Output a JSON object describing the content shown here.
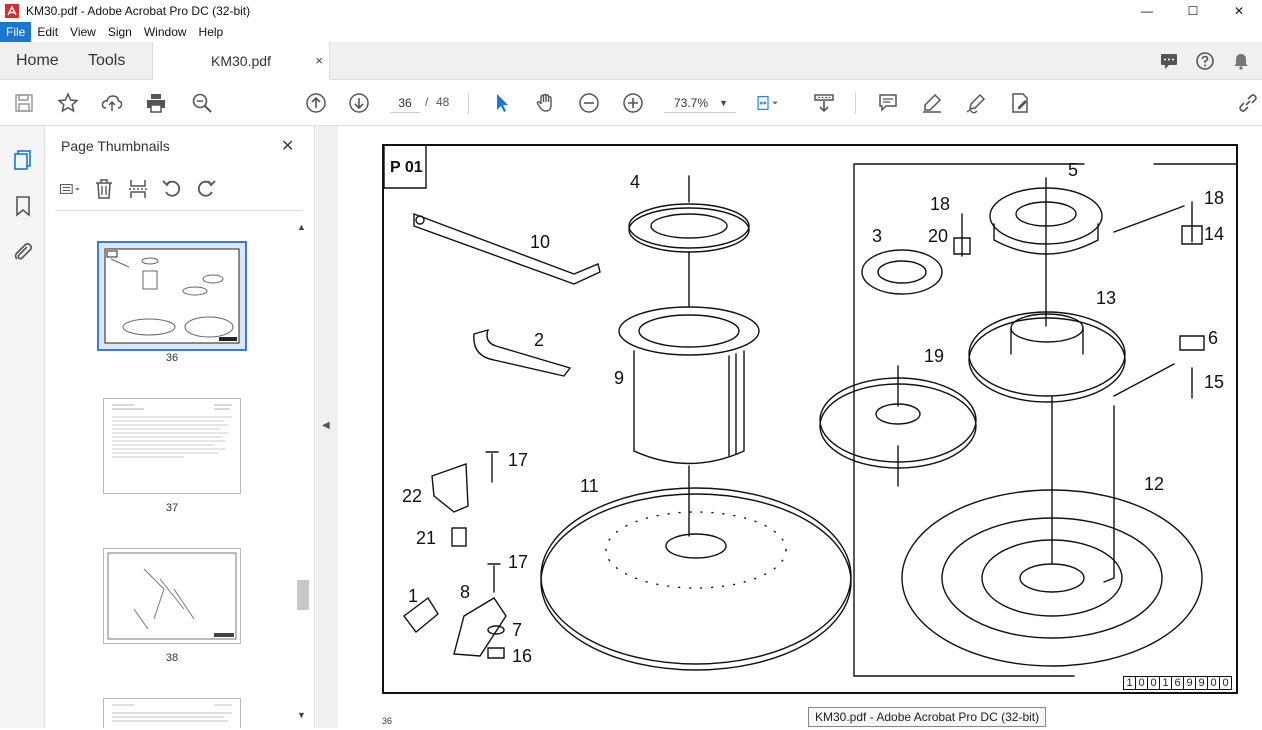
{
  "window": {
    "title": "KM30.pdf - Adobe Acrobat Pro DC (32-bit)",
    "controls": [
      "—",
      "☐",
      "✕"
    ]
  },
  "menu": [
    "File",
    "Edit",
    "View",
    "Sign",
    "Window",
    "Help"
  ],
  "tabs": {
    "home": "Home",
    "tools": "Tools",
    "document": "KM30.pdf",
    "close": "×"
  },
  "toolbar": {
    "current_page": "36",
    "page_separator": "/",
    "total_pages": "48",
    "zoom": "73.7%"
  },
  "panel": {
    "title": "Page Thumbnails",
    "close": "✕",
    "thumbnails": [
      {
        "label": "36",
        "selected": true
      },
      {
        "label": "37",
        "selected": false
      },
      {
        "label": "38",
        "selected": false
      }
    ]
  },
  "document": {
    "panel_label": "P 01",
    "part_code": [
      "1",
      "0",
      "0",
      "1",
      "6",
      "9",
      "9",
      "0",
      "0"
    ],
    "page_number_footer": "36",
    "callouts": [
      "4",
      "10",
      "2",
      "9",
      "11",
      "17",
      "22",
      "21",
      "17",
      "1",
      "8",
      "7",
      "16",
      "5",
      "18",
      "14",
      "3",
      "18",
      "20",
      "13",
      "6",
      "15",
      "19",
      "12"
    ]
  },
  "tooltip": "KM30.pdf - Adobe Acrobat Pro DC (32-bit)",
  "colors": {
    "accent": "#1976d2",
    "selection": "#3c7dd4",
    "app_red": "#d32f2f"
  }
}
